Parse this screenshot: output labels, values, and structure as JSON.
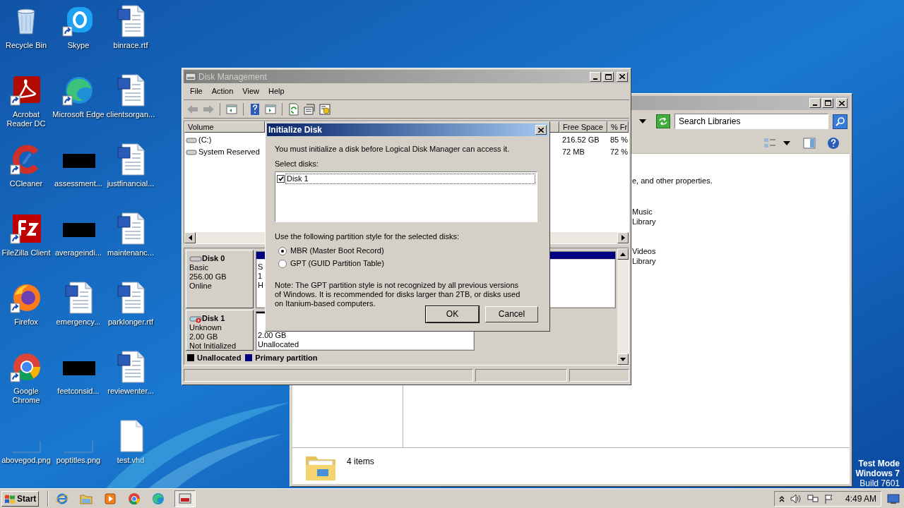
{
  "desktop_icons": [
    {
      "label": "Recycle Bin",
      "kind": "recycle",
      "shortcut": false
    },
    {
      "label": "Acrobat Reader DC",
      "kind": "acrobat",
      "shortcut": true
    },
    {
      "label": "CCleaner",
      "kind": "ccleaner",
      "shortcut": true
    },
    {
      "label": "FileZilla Client",
      "kind": "filezilla",
      "shortcut": true
    },
    {
      "label": "Firefox",
      "kind": "firefox",
      "shortcut": true
    },
    {
      "label": "Google Chrome",
      "kind": "chrome",
      "shortcut": true
    },
    {
      "label": "abovegod.png",
      "kind": "blank",
      "shortcut": false
    },
    {
      "label": "Skype",
      "kind": "skype",
      "shortcut": true
    },
    {
      "label": "Microsoft Edge",
      "kind": "edge",
      "shortcut": true
    },
    {
      "label": "assessment...",
      "kind": "redacted",
      "shortcut": false
    },
    {
      "label": "averageindi...",
      "kind": "redacted",
      "shortcut": false
    },
    {
      "label": "emergency...",
      "kind": "word",
      "shortcut": false
    },
    {
      "label": "feetconsid...",
      "kind": "redacted",
      "shortcut": false
    },
    {
      "label": "poptitles.png",
      "kind": "blank",
      "shortcut": false
    },
    {
      "label": "binrace.rtf",
      "kind": "word",
      "shortcut": false
    },
    {
      "label": "clientsorgan...",
      "kind": "word",
      "shortcut": false
    },
    {
      "label": "justfinancial...",
      "kind": "word",
      "shortcut": false
    },
    {
      "label": "maintenanc...",
      "kind": "word",
      "shortcut": false
    },
    {
      "label": "parklonger.rtf",
      "kind": "word",
      "shortcut": false
    },
    {
      "label": "reviewenter...",
      "kind": "word",
      "shortcut": false
    },
    {
      "label": "test.vhd",
      "kind": "file",
      "shortcut": false
    }
  ],
  "explorer_window": {
    "search": {
      "placeholder": "Search Libraries"
    },
    "description": "e, and other properties.",
    "libraries": [
      {
        "name": "Music",
        "type": "Library"
      },
      {
        "name": "Videos",
        "type": "Library"
      }
    ],
    "status": "4 items"
  },
  "disk_management": {
    "title": "Disk Management",
    "menu": [
      "File",
      "Action",
      "View",
      "Help"
    ],
    "columns": [
      "Volume",
      "Free Space",
      "% Fr"
    ],
    "volumes": [
      {
        "name": "(C:)",
        "free": "216.52 GB",
        "percent": "85 %"
      },
      {
        "name": "System Reserved",
        "free": "72 MB",
        "percent": "72 %"
      }
    ],
    "disks": [
      {
        "name": "Disk 0",
        "kind": "online",
        "details": [
          "Basic",
          "256.00 GB",
          "Online"
        ],
        "partitions": [
          {
            "lines": [
              "S",
              "1",
              "H"
            ],
            "color": "#000080"
          },
          {
            "color": "#000080"
          }
        ]
      },
      {
        "name": "Disk 1",
        "kind": "uninitialized",
        "details": [
          "Unknown",
          "2.00 GB",
          "Not Initialized"
        ],
        "partitions": [
          {
            "lines": [
              "2.00 GB",
              "Unallocated"
            ],
            "color": "#000000"
          }
        ]
      }
    ],
    "legend": [
      {
        "label": "Unallocated",
        "color": "#000000"
      },
      {
        "label": "Primary partition",
        "color": "#000080"
      }
    ]
  },
  "dialog": {
    "title": "Initialize Disk",
    "message": "You must initialize a disk before Logical Disk Manager can access it.",
    "select_label": "Select disks:",
    "disks": [
      {
        "label": "Disk 1",
        "checked": true
      }
    ],
    "style_label": "Use the following partition style for the selected disks:",
    "styles": [
      {
        "label": "MBR (Master Boot Record)",
        "selected": true
      },
      {
        "label": "GPT (GUID Partition Table)",
        "selected": false
      }
    ],
    "note": "Note: The GPT partition style is not recognized by all previous versions of Windows. It is recommended for disks larger than 2TB, or disks used on Itanium-based computers.",
    "buttons": [
      "OK",
      "Cancel"
    ]
  },
  "system_notice": [
    "Test Mode",
    "Windows 7",
    "Build 7601"
  ],
  "taskbar": {
    "start": "Start",
    "apps": [
      {
        "kind": "ie",
        "active": false
      },
      {
        "kind": "explorer",
        "active": false
      },
      {
        "kind": "media",
        "active": false
      },
      {
        "kind": "chrome",
        "active": false
      },
      {
        "kind": "edge",
        "active": false
      },
      {
        "kind": "diskmgmt",
        "active": true
      }
    ],
    "time": "4:49 AM"
  }
}
